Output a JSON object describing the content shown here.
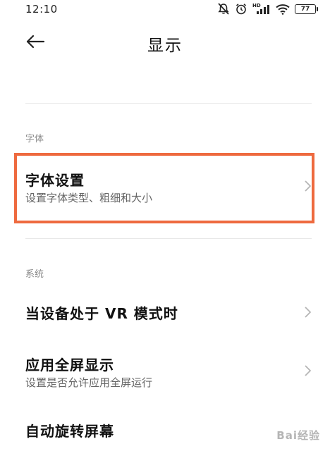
{
  "status_bar": {
    "time": "12:10",
    "battery": "77",
    "network_label": "HD"
  },
  "header": {
    "back_icon": "arrow-left-icon",
    "title": "显示"
  },
  "sections": [
    {
      "title": "字体",
      "items": [
        {
          "title": "字体设置",
          "subtitle": "设置字体类型、粗细和大小"
        }
      ]
    },
    {
      "title": "系统",
      "items": [
        {
          "title": "当设备处于 VR 模式时"
        },
        {
          "title": "应用全屏显示",
          "subtitle": "设置是否允许应用全屏运行"
        },
        {
          "title": "自动旋转屏幕"
        }
      ]
    }
  ],
  "highlight_color": "#ee6a3f",
  "watermark": "Bai经验"
}
